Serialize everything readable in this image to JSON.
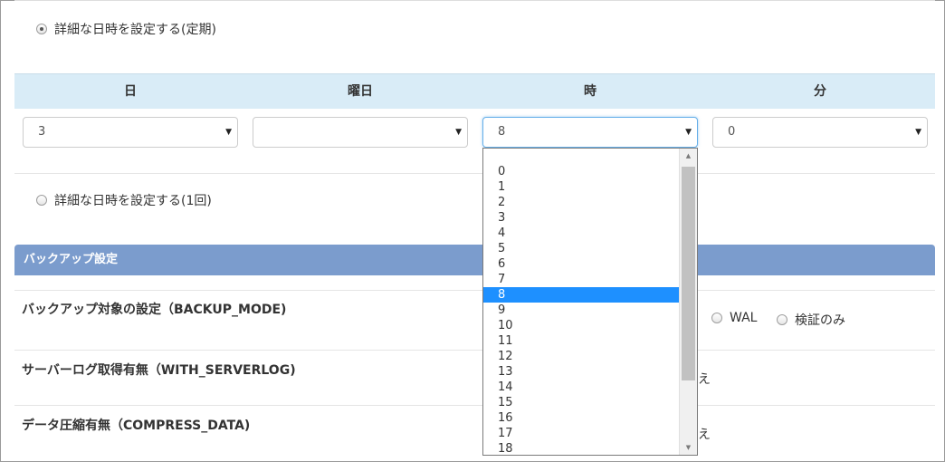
{
  "schedule": {
    "periodic_radio_label": "詳細な日時を設定する(定期)",
    "once_radio_label": "詳細な日時を設定する(1回)",
    "headers": [
      "日",
      "曜日",
      "時",
      "分"
    ],
    "selects": {
      "day_value": "3",
      "weekday_value": "",
      "hour_value": "8",
      "minute_value": "0"
    }
  },
  "backup_section": {
    "title": "バックアップ設定",
    "settings": [
      {
        "label": "バックアップ対象の設定（BACKUP_MODE)"
      },
      {
        "label": "サーバーログ取得有無（WITH_SERVERLOG)"
      },
      {
        "label": "データ圧縮有無（COMPRESS_DATA)"
      }
    ],
    "backup_mode_options": [
      "WAL",
      "検証のみ"
    ],
    "partial_text": "え"
  },
  "hour_dropdown": {
    "options": [
      "0",
      "1",
      "2",
      "3",
      "4",
      "5",
      "6",
      "7",
      "8",
      "9",
      "10",
      "11",
      "12",
      "13",
      "14",
      "15",
      "16",
      "17",
      "18"
    ],
    "selected": "8"
  },
  "icons": {
    "select_arrow": "▼",
    "scroll_up": "▲",
    "scroll_down": "▼"
  },
  "colors": {
    "header_bg": "#d9ecf7",
    "section_bar": "#7b9ccd",
    "selected_option": "#1e90ff"
  }
}
